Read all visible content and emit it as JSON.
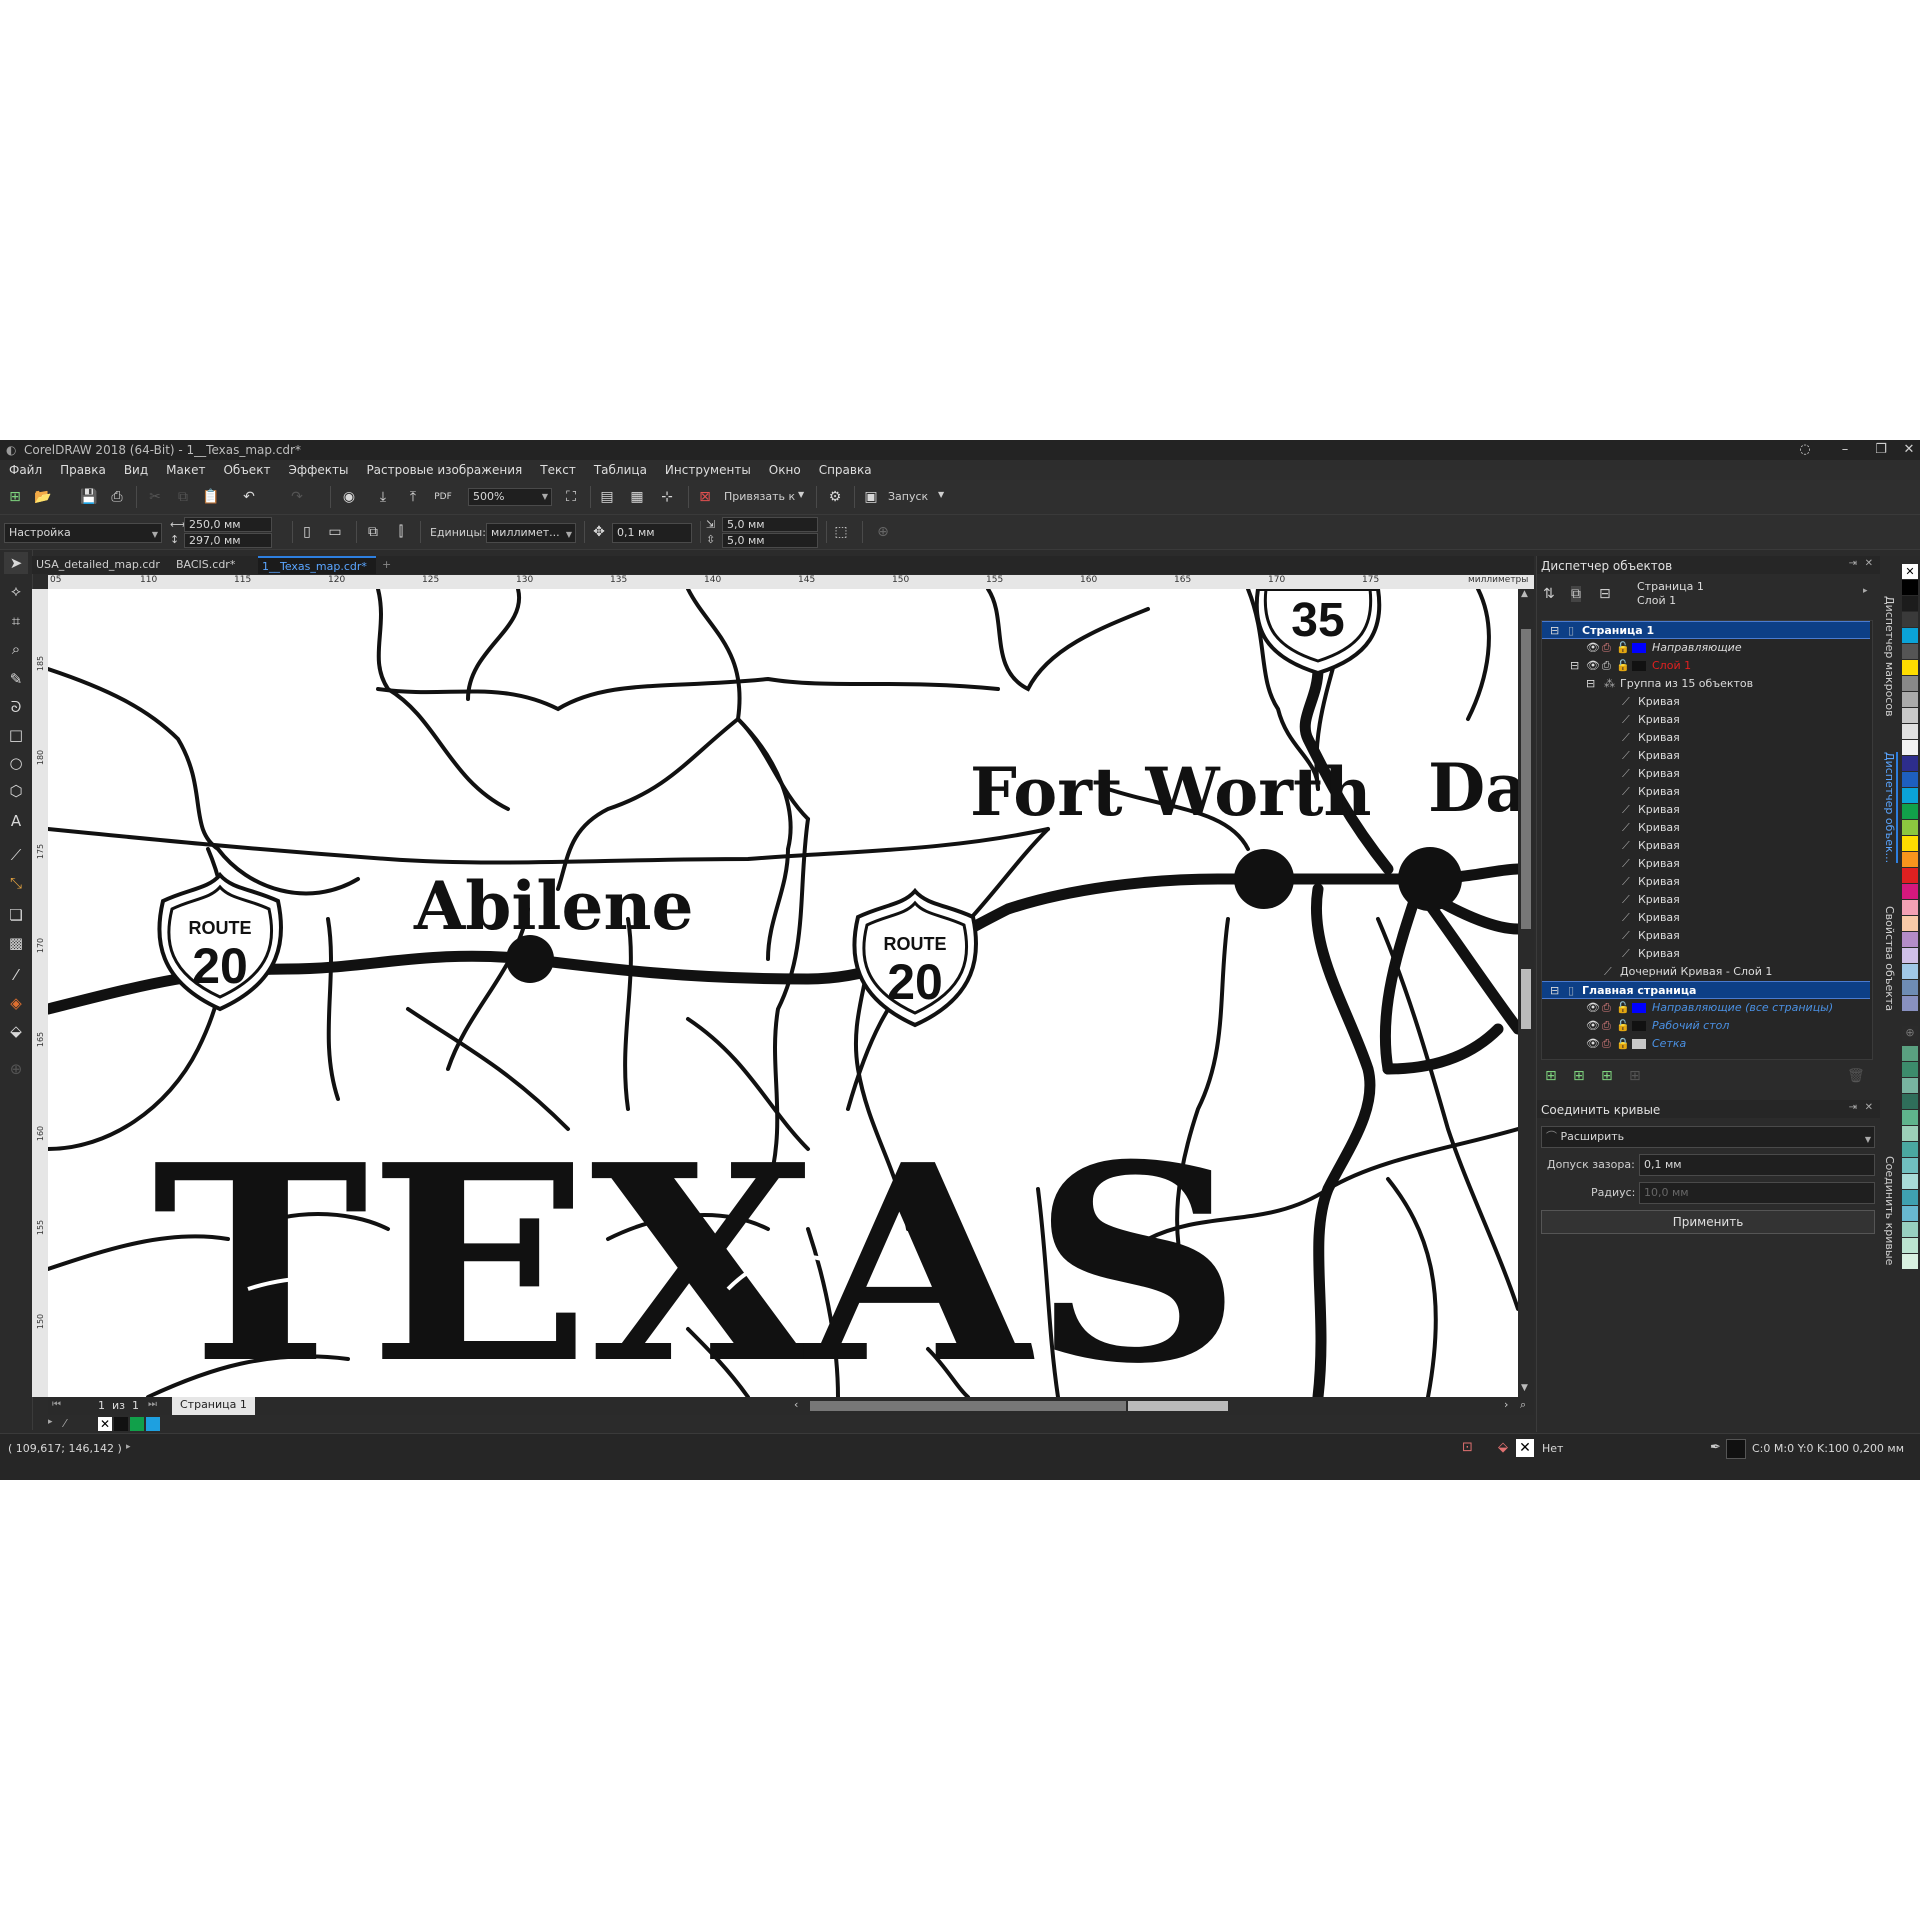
{
  "window": {
    "title": "CorelDRAW 2018 (64-Bit) - 1__Texas_map.cdr*"
  },
  "menu": [
    "Файл",
    "Правка",
    "Вид",
    "Макет",
    "Объект",
    "Эффекты",
    "Растровые изображения",
    "Текст",
    "Таблица",
    "Инструменты",
    "Окно",
    "Справка"
  ],
  "toolbar": {
    "zoom": "500%",
    "snap_label": "Привязать к",
    "launch_label": "Запуск"
  },
  "propbar": {
    "preset": "Настройка",
    "width": "250,0 мм",
    "height": "297,0 мм",
    "units_label": "Единицы:",
    "units": "миллимет...",
    "nudge": "0,1 мм",
    "dup_x": "5,0 мм",
    "dup_y": "5,0 мм"
  },
  "tabs": [
    "USA_detailed_map.cdr",
    "BACIS.cdr*",
    "1__Texas_map.cdr*"
  ],
  "ruler": {
    "unit": "миллиметры",
    "h_ticks": [
      "05",
      "110",
      "115",
      "120",
      "125",
      "130",
      "135",
      "140",
      "145",
      "150",
      "155",
      "160",
      "165",
      "170",
      "175"
    ],
    "v_ticks": [
      "185",
      "180",
      "175",
      "170",
      "165",
      "160",
      "155",
      "150"
    ]
  },
  "map": {
    "cities": [
      "Abilene",
      "Fort Worth",
      "Da"
    ],
    "shields": [
      {
        "top": "ROUTE",
        "num": "20"
      },
      {
        "top": "ROUTE",
        "num": "20"
      },
      {
        "num": "35"
      }
    ],
    "title": "TEXAS"
  },
  "pager": {
    "current": "1",
    "of": "из",
    "total": "1",
    "page_tab": "Страница 1"
  },
  "status": {
    "coords": "( 109,617; 146,142 )",
    "fill": "Нет",
    "outline": "C:0 M:0 Y:0 K:100  0,200 мм"
  },
  "objmgr": {
    "title": "Диспетчер объектов",
    "current_page": "Страница 1",
    "current_layer": "Слой 1",
    "rows": [
      {
        "label": "Страница 1",
        "sel": true
      },
      {
        "label": "Направляющие"
      },
      {
        "label": "Слой 1"
      },
      {
        "label": "Группа из 15 объектов"
      },
      {
        "label": "Кривая"
      },
      {
        "label": "Кривая"
      },
      {
        "label": "Кривая"
      },
      {
        "label": "Кривая"
      },
      {
        "label": "Кривая"
      },
      {
        "label": "Кривая"
      },
      {
        "label": "Кривая"
      },
      {
        "label": "Кривая"
      },
      {
        "label": "Кривая"
      },
      {
        "label": "Кривая"
      },
      {
        "label": "Кривая"
      },
      {
        "label": "Кривая"
      },
      {
        "label": "Кривая"
      },
      {
        "label": "Кривая"
      },
      {
        "label": "Кривая"
      },
      {
        "label": "Дочерний Кривая - Слой 1"
      },
      {
        "label": "Главная страница",
        "sel": true
      },
      {
        "label": "Направляющие (все страницы)"
      },
      {
        "label": "Рабочий стол"
      },
      {
        "label": "Сетка"
      }
    ]
  },
  "join": {
    "title": "Соединить кривые",
    "mode": "Расширить",
    "gap_label": "Допуск зазора:",
    "gap": "0,1 мм",
    "radius_label": "Радиус:",
    "radius": "10,0 мм",
    "apply": "Применить"
  },
  "side_tabs": [
    "Диспетчер макросов",
    "Диспетчер объек...",
    "Свойства объекта",
    "Соединить кривые"
  ],
  "colors": {
    "accent": "#0d3f86",
    "red_layer": "#e02020",
    "blue_label": "#4a90e2"
  }
}
